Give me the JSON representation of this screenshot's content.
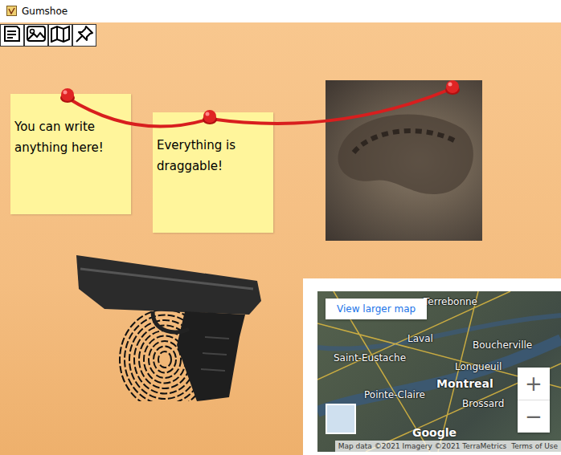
{
  "window": {
    "title": "Gumshoe"
  },
  "notes": [
    {
      "text": "You can write anything here!"
    },
    {
      "text": "Everything is draggable!"
    }
  ],
  "map": {
    "link": "View larger map",
    "labels": [
      {
        "text": "Terrebonne"
      },
      {
        "text": "Laval"
      },
      {
        "text": "Boucherville"
      },
      {
        "text": "Saint-Eustache"
      },
      {
        "text": "Longueuil"
      },
      {
        "text": "Montreal"
      },
      {
        "text": "Pointe-Claire"
      },
      {
        "text": "Brossard"
      }
    ],
    "zoom_in": "+",
    "zoom_out": "−",
    "logo": "Google",
    "attribution": "Map data ©2021 Imagery ©2021 TerraMetrics",
    "terms": "Terms of Use"
  }
}
